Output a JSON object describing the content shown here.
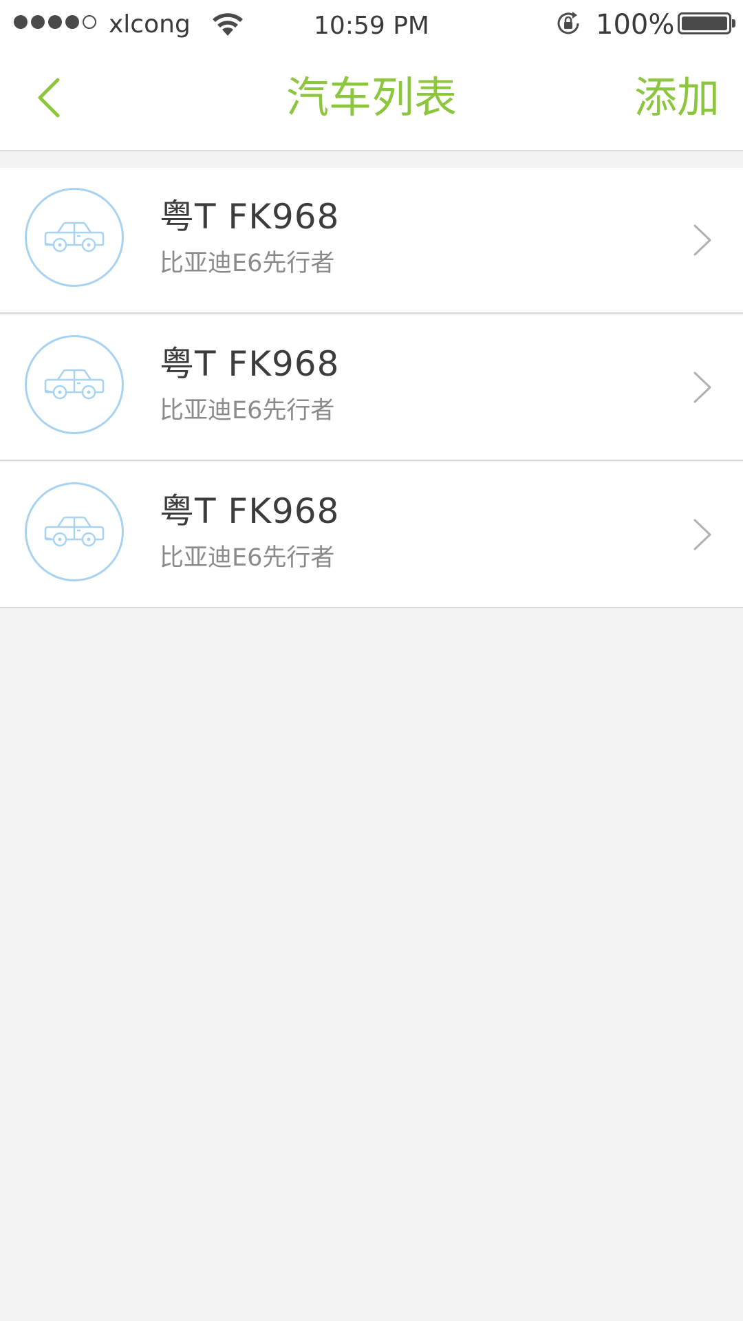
{
  "status_bar": {
    "signal_bars": 4,
    "signal_total": 5,
    "carrier": "xlcong",
    "wifi_icon": "wifi-icon",
    "time": "10:59 PM",
    "orientation_lock_icon": "orientation-lock-icon",
    "battery_percent": "100%",
    "battery_level": 1.0
  },
  "nav": {
    "back_icon": "chevron-left-icon",
    "title": "汽车列表",
    "add_label": "添加"
  },
  "colors": {
    "accent": "#8cc63e",
    "avatar_stroke": "#a8d2f1",
    "primary_text": "#3c3c3c",
    "secondary_text": "#8a8a8a",
    "background": "#f3f3f3"
  },
  "cars": [
    {
      "plate": "粤T FK968",
      "model": "比亚迪E6先行者",
      "icon": "car-icon"
    },
    {
      "plate": "粤T FK968",
      "model": "比亚迪E6先行者",
      "icon": "car-icon"
    },
    {
      "plate": "粤T FK968",
      "model": "比亚迪E6先行者",
      "icon": "car-icon"
    }
  ]
}
